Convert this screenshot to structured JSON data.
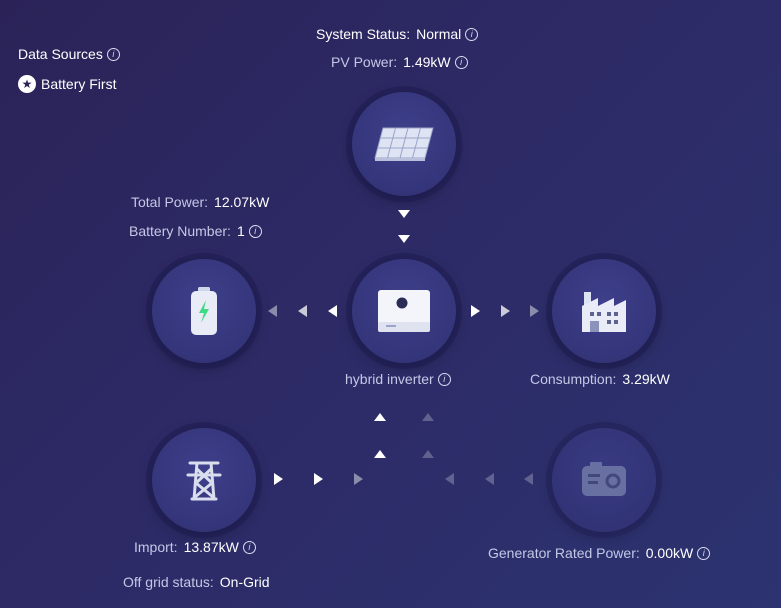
{
  "data_sources": {
    "label": "Data Sources",
    "mode": "Battery First"
  },
  "system": {
    "status_label": "System Status:",
    "status_value": "Normal",
    "pv_label": "PV Power:",
    "pv_value": "1.49kW"
  },
  "battery": {
    "total_label": "Total Power:",
    "total_value": "12.07kW",
    "number_label": "Battery Number:",
    "number_value": "1"
  },
  "inverter": {
    "label": "hybrid inverter"
  },
  "consumption": {
    "label": "Consumption:",
    "value": "3.29kW"
  },
  "grid": {
    "import_label": "Import:",
    "import_value": "13.87kW",
    "offgrid_label": "Off grid status:",
    "offgrid_value": "On-Grid"
  },
  "generator": {
    "label": "Generator Rated Power:",
    "value": "0.00kW"
  },
  "colors": {
    "accent_green": "#3ddc84",
    "label": "#c4c8e6"
  }
}
